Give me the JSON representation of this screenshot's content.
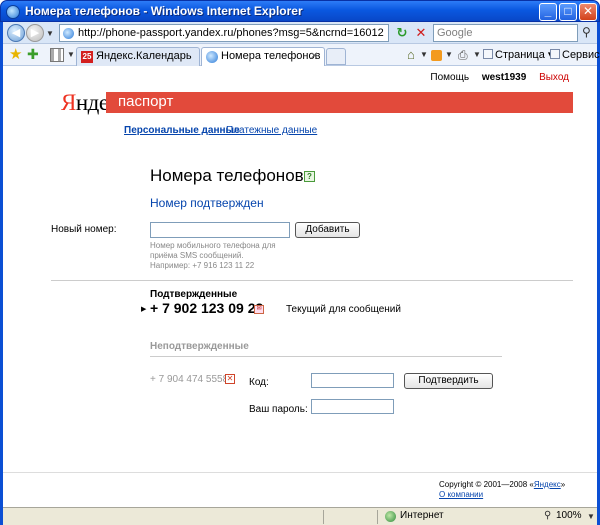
{
  "window": {
    "title": "Номера телефонов - Windows Internet Explorer",
    "minimize_glyph": "_",
    "maximize_glyph": "□",
    "close_glyph": "✕"
  },
  "address_bar": {
    "url": "http://phone-passport.yandex.ru/phones?msg=5&ncrnd=16012",
    "search_placeholder": "Google"
  },
  "tabs": [
    {
      "label": "Яндекс.Календарь",
      "icon": "calendar-icon",
      "icon_text": "25",
      "active": false
    },
    {
      "label": "Номера телефонов",
      "icon": "ie-page-icon",
      "active": true
    }
  ],
  "command_bar": {
    "page_label": "Страница",
    "tools_label": "Сервис"
  },
  "header": {
    "help": "Помощь",
    "username": "west1939",
    "logout": "Выход",
    "logo_first": "Я",
    "logo_rest": "ндекс",
    "service": "паспорт"
  },
  "nav": {
    "personal": "Персональные данные",
    "payment": "Платежные данные"
  },
  "main": {
    "title": "Номера телефонов",
    "help_glyph": "?",
    "status_message": "Номер подтвержден",
    "new_number_label": "Новый номер:",
    "new_number_value": "",
    "add_button": "Добавить",
    "hint": "Номер мобильного телефона для приёма SMS сообщений. Например: +7 916 123 11 22"
  },
  "confirmed": {
    "heading": "Подтвержденные",
    "arrow": "▶",
    "number": "+ 7 902 123 09 23",
    "sms_glyph": "✉",
    "current_label": "Текущий для сообщений"
  },
  "unconfirmed": {
    "heading": "Неподтвержденные",
    "number": "+ 7 904 474 5558",
    "delete_glyph": "✕",
    "code_label": "Код:",
    "code_value": "",
    "verify_button": "Подтвердить",
    "password_label": "Ваш пароль:",
    "password_value": ""
  },
  "footer": {
    "copyright_prefix": "Copyright © 2001—2008 «",
    "copyright_link": "Яндекс",
    "copyright_suffix": "»",
    "about": "О компании"
  },
  "statusbar": {
    "zone": "Интернет",
    "zoom": "100%"
  },
  "colors": {
    "brand_red": "#e24a3b",
    "link_blue": "#0645ad"
  }
}
